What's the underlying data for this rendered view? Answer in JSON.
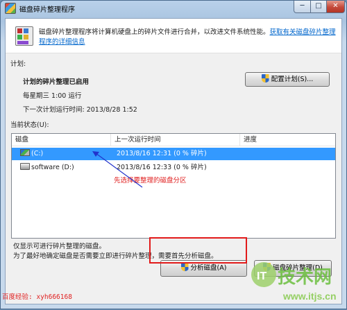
{
  "window": {
    "title": "磁盘碎片整理程序",
    "min_glyph": "─",
    "max_glyph": "□",
    "close_glyph": "✕"
  },
  "header": {
    "description": "磁盘碎片整理程序将计算机硬盘上的碎片文件进行合并，以改进文件系统性能。",
    "help_link": "获取有关磁盘碎片整理程序的详细信息"
  },
  "schedule": {
    "section_label": "计划:",
    "enabled_text": "计划的碎片整理已启用",
    "frequency_text": "每星期三  1:00 运行",
    "next_run_text": "下一次计划运行时间: 2013/8/28 1:52",
    "configure_button": "配置计划(S)..."
  },
  "status": {
    "section_label": "当前状态(U):",
    "columns": [
      "磁盘",
      "上一次运行时间",
      "进度"
    ],
    "rows": [
      {
        "disk": "(C:)",
        "last_run": "2013/8/16 12:31 (0 % 碎片)",
        "progress": "",
        "selected": true,
        "icon": "system-drive-icon"
      },
      {
        "disk": "software (D:)",
        "last_run": "2013/8/16 12:33 (0 % 碎片)",
        "progress": "",
        "selected": false,
        "icon": "hard-drive-icon"
      }
    ]
  },
  "annotation": {
    "text": "先选择要整理的磁盘分区",
    "color": "#e02020"
  },
  "footer": {
    "line1": "仅显示可进行碎片整理的磁盘。",
    "line2": "为了最好地确定磁盘是否需要立即进行碎片整理，需要首先分析磁盘。",
    "analyze_button": "分析磁盘(A)",
    "defrag_button": "磁盘碎片整理(D)"
  },
  "watermarks": {
    "left": "百度经验: xyh666168",
    "site_name": "技术网",
    "site_url": "www.itjs.cn",
    "site_badge": "IT"
  },
  "colors": {
    "selection": "#3399ff",
    "link": "#0066cc",
    "highlight_box": "#e21a1a",
    "arrow": "#2233cc"
  }
}
